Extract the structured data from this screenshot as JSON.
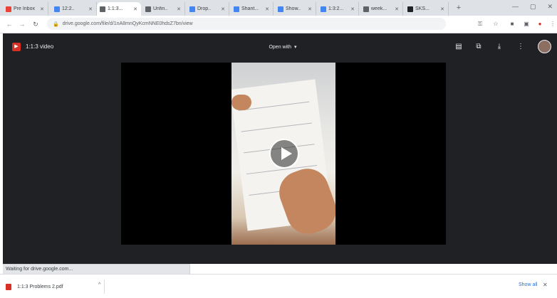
{
  "browser": {
    "tabs": [
      {
        "label": "Pre Inbox",
        "favicon_color": "#ea4335"
      },
      {
        "label": "12:2..",
        "favicon_color": "#4285f4"
      },
      {
        "label": "1:1:3...",
        "favicon_color": "#5f6368",
        "active": true
      },
      {
        "label": "Unfin..",
        "favicon_color": "#5f6368"
      },
      {
        "label": "Drop..",
        "favicon_color": "#4285f4"
      },
      {
        "label": "Shant...",
        "favicon_color": "#4285f4"
      },
      {
        "label": "Show..",
        "favicon_color": "#4285f4"
      },
      {
        "label": "1:3:2...",
        "favicon_color": "#4285f4"
      },
      {
        "label": "week...",
        "favicon_color": "#5f6368"
      },
      {
        "label": "SKS...",
        "favicon_color": "#202124"
      }
    ],
    "new_tab_symbol": "+",
    "window_controls": [
      "—",
      "▢",
      "✕"
    ],
    "url": "drive.google.com/file/d/1nA8mnQyKcmNNE0hdsZ7bn/view",
    "accent": "#1a73e8"
  },
  "viewer": {
    "file_name": "1:1:3 video",
    "open_with_label": "Open with",
    "header_icons": [
      "add-to-drive-icon",
      "new-window-icon",
      "download-icon",
      "more-vert-icon",
      "avatar"
    ],
    "background_color": "#202124"
  },
  "status_bar": {
    "text": "Waiting for drive.google.com..."
  },
  "download_shelf": {
    "item_label": "1:1:3 Problems 2.pdf",
    "show_all_label": "Show all",
    "close_symbol": "✕"
  }
}
